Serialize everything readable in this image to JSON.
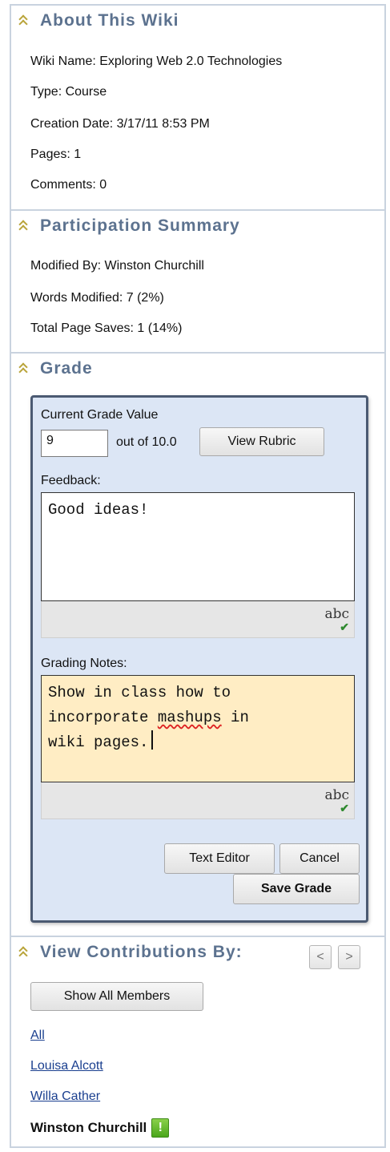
{
  "about": {
    "title": "About This Wiki",
    "wiki_name": "Wiki Name: Exploring Web 2.0 Technologies",
    "type": "Type: Course",
    "creation_date": "Creation Date: 3/17/11 8:53 PM",
    "pages": "Pages: 1",
    "comments": "Comments: 0"
  },
  "participation": {
    "title": "Participation Summary",
    "modified_by": "Modified By: Winston Churchill",
    "words_modified": "Words Modified: 7 (2%)",
    "total_page_saves": "Total Page Saves: 1 (14%)"
  },
  "grade": {
    "title": "Grade",
    "current_grade_label": "Current Grade Value",
    "grade_value": "9",
    "out_of": "out of 10.0",
    "view_rubric": "View Rubric",
    "feedback_label": "Feedback:",
    "feedback_text": "Good ideas!",
    "grading_notes_label": "Grading Notes:",
    "notes_line1": "Show in class how to",
    "notes_line2a": "incorporate ",
    "notes_line2b": "mashups",
    "notes_line2c": " in",
    "notes_line3": "wiki pages.",
    "spellcheck_label": "abc",
    "text_editor": "Text Editor",
    "cancel": "Cancel",
    "save_grade": "Save Grade",
    "colors": {
      "card_bg": "#dce6f5",
      "notes_bg": "#ffedc4",
      "header_text": "#5c728f"
    }
  },
  "contributions": {
    "title": "View Contributions By:",
    "prev_glyph": "<",
    "next_glyph": ">",
    "show_all": "Show All Members",
    "members": [
      "All",
      "Louisa Alcott",
      "Willa Cather"
    ],
    "selected_member": "Winston Churchill",
    "badge": "!"
  }
}
